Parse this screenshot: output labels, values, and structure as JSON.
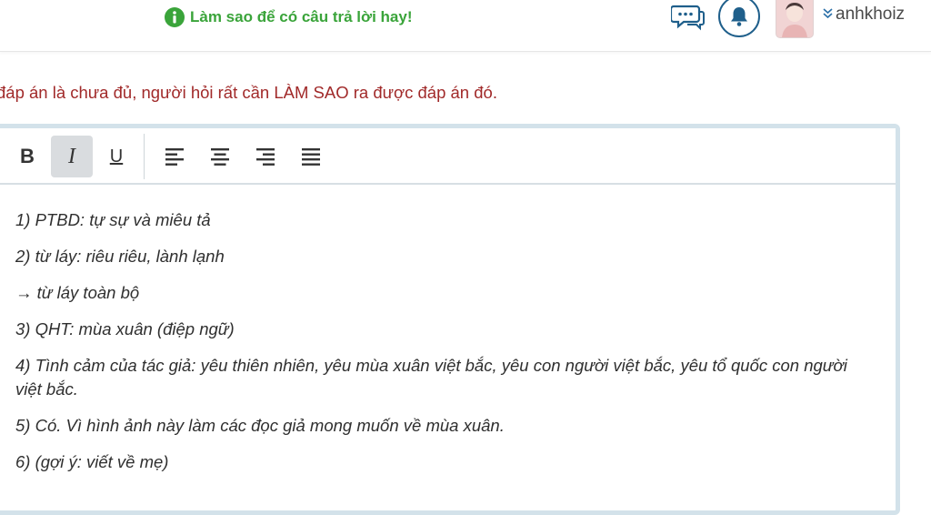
{
  "header": {
    "howto_label": "Làm sao để có câu trả lời hay!",
    "username": "anhkhoiz",
    "icons": [
      "info-icon",
      "chat-icon",
      "bell-icon",
      "chevron-double-down-icon"
    ]
  },
  "notice": "đáp án là chưa đủ, người hỏi rất cần LÀM SAO ra được đáp án đó.",
  "toolbar": {
    "bold_label": "B",
    "italic_label": "I",
    "underline_label": "U",
    "align_icons": [
      "align-left-icon",
      "align-center-icon",
      "align-right-icon",
      "align-justify-icon"
    ]
  },
  "content": {
    "lines": [
      "1) PTBD: tự sự và miêu tả",
      "2) từ láy: riêu riêu, lành lạnh",
      "→ từ láy toàn bộ",
      "3) QHT: mùa xuân  (điệp ngữ)",
      "4) Tình cảm của tác giả: yêu thiên nhiên, yêu mùa xuân việt bắc, yêu con người việt bắc, yêu tổ quốc con người việt bắc.",
      "5) Có. Vì hình ảnh này làm các đọc giả mong muốn về mùa xuân.",
      "6) (gợi ý: viết về mẹ)"
    ]
  },
  "colors": {
    "accent_green": "#3aa43a",
    "notice_red": "#a12a2a",
    "icon_blue": "#1f5f8b",
    "editor_border": "#d3e2ea"
  }
}
